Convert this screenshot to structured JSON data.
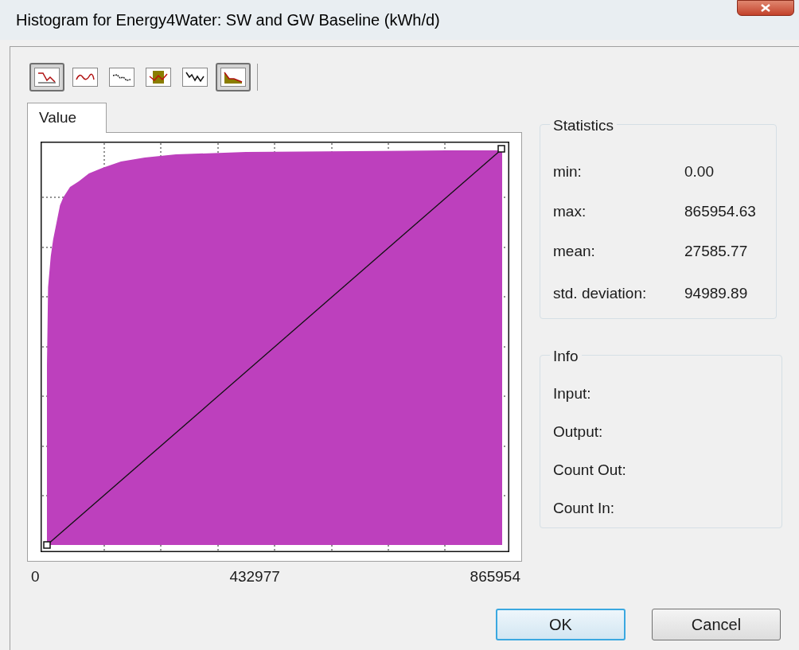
{
  "window": {
    "title": "Histogram for Energy4Water: SW and GW Baseline (kWh/d)"
  },
  "toolbar": [
    {
      "kind": "step",
      "selected": true
    },
    {
      "kind": "wave",
      "selected": false
    },
    {
      "kind": "dots",
      "selected": false
    },
    {
      "kind": "band",
      "selected": false
    },
    {
      "kind": "zigzag",
      "selected": false
    },
    {
      "kind": "area",
      "selected": true
    }
  ],
  "tabs": [
    {
      "label": "Value",
      "selected": true
    }
  ],
  "histogram": {
    "x_labels": [
      "0",
      "432977",
      "865954"
    ]
  },
  "statistics": {
    "title": "Statistics",
    "rows": [
      {
        "label": "min:",
        "value": "0.00"
      },
      {
        "label": "max:",
        "value": "865954.63"
      },
      {
        "label": "mean:",
        "value": "27585.77"
      },
      {
        "label": "std. deviation:",
        "value": "94989.89"
      }
    ]
  },
  "info": {
    "title": "Info",
    "rows": [
      "Input:",
      "Output:",
      "Count Out:",
      "Count In:"
    ]
  },
  "buttons": [
    {
      "label": "OK",
      "kind": "default"
    },
    {
      "label": "Cancel",
      "kind": "normal"
    }
  ]
}
